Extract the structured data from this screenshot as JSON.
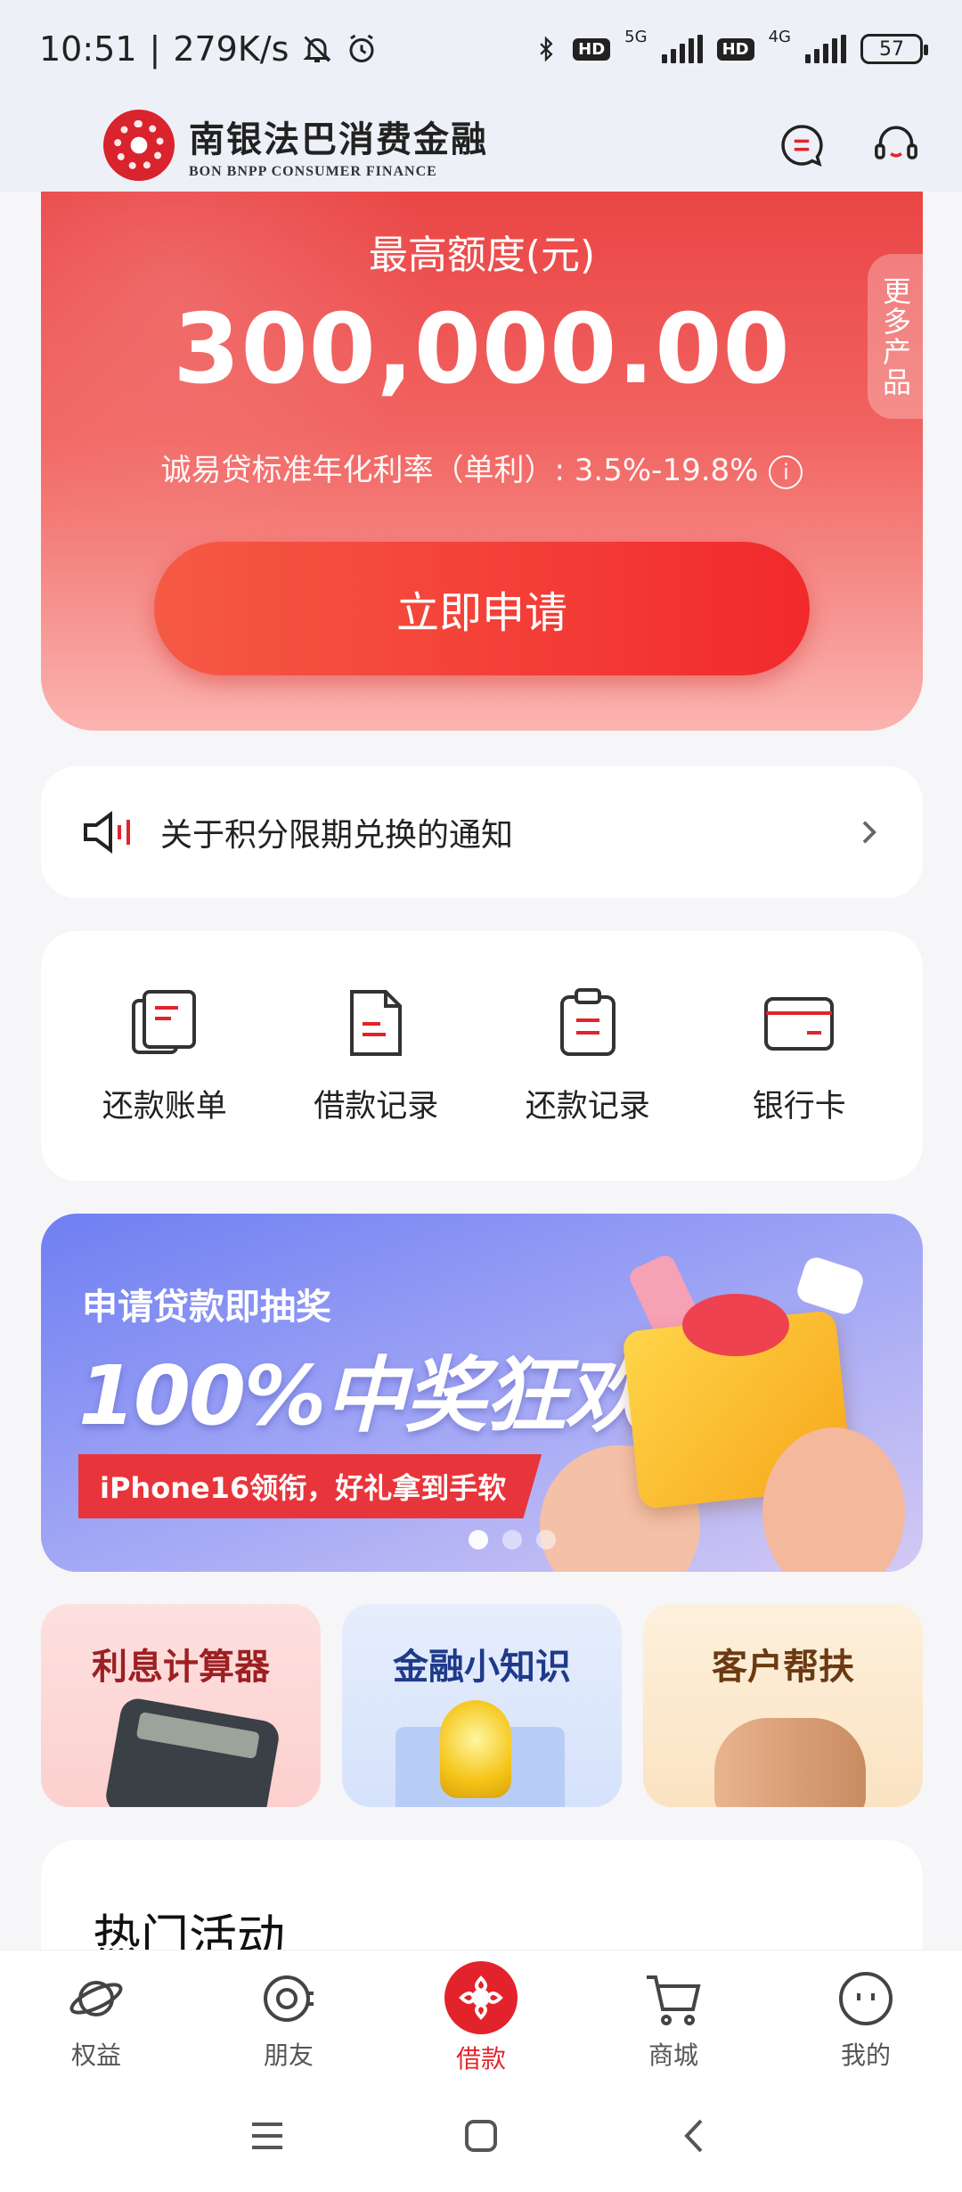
{
  "status_bar": {
    "time": "10:51",
    "speed": "279K/s",
    "network_1": "5G",
    "network_2": "4G",
    "hd": "HD",
    "battery": "57"
  },
  "header": {
    "brand_cn": "南银法巴消费金融",
    "brand_en": "BON BNPP CONSUMER FINANCE"
  },
  "hero": {
    "label": "最高额度(元)",
    "amount": "300,000.00",
    "rate_text": "诚易贷标准年化利率（单利）: 3.5%-19.8%",
    "apply_label": "立即申请",
    "more_products": "更多产品"
  },
  "notice": {
    "text": "关于积分限期兑换的通知"
  },
  "quick_actions": [
    {
      "label": "还款账单",
      "icon": "bill-icon"
    },
    {
      "label": "借款记录",
      "icon": "document-icon"
    },
    {
      "label": "还款记录",
      "icon": "clipboard-icon"
    },
    {
      "label": "银行卡",
      "icon": "bank-card-icon"
    }
  ],
  "banner": {
    "subtitle": "申请贷款即抽奖",
    "title": "100%中奖狂欢",
    "tag": "iPhone16领衔，好礼拿到手软",
    "page_count": 3,
    "active_page": 1
  },
  "features": [
    {
      "label": "利息计算器"
    },
    {
      "label": "金融小知识"
    },
    {
      "label": "客户帮扶"
    }
  ],
  "hot": {
    "title": "热门活动"
  },
  "bottom_nav": [
    {
      "label": "权益",
      "icon": "planet-icon"
    },
    {
      "label": "朋友",
      "icon": "friends-icon"
    },
    {
      "label": "借款",
      "icon": "loan-icon",
      "active": true
    },
    {
      "label": "商城",
      "icon": "cart-icon"
    },
    {
      "label": "我的",
      "icon": "profile-icon"
    }
  ],
  "colors": {
    "brand": "#e3232b",
    "hero_top": "#ea4545",
    "banner": "#6f7ff2"
  }
}
